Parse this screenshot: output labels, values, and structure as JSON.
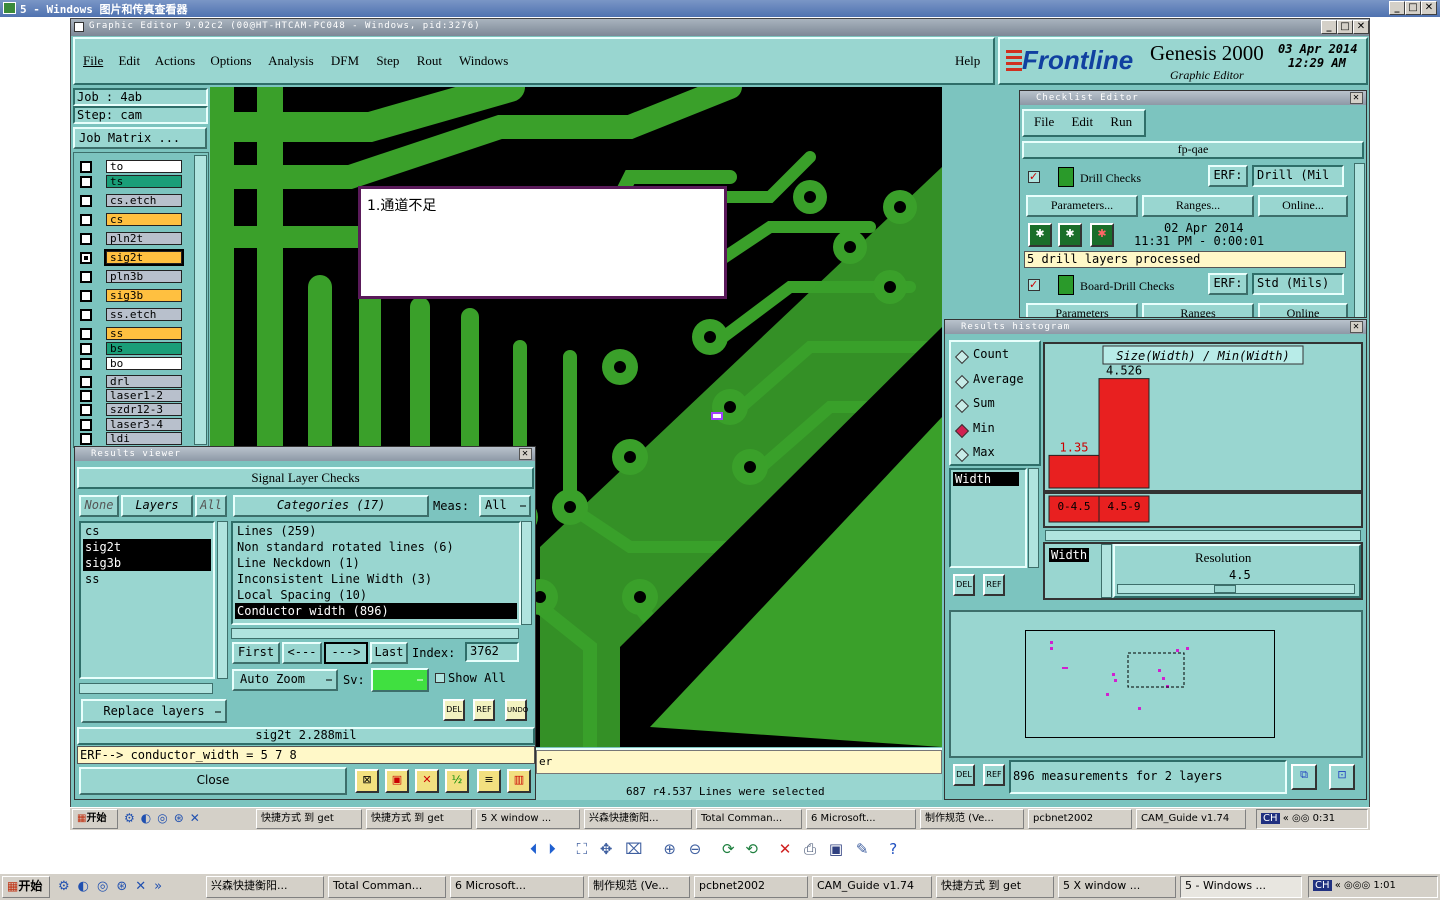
{
  "outer_title": "5 - Windows 图片和传真查看器",
  "editor_title": "Graphic Editor 9.02c2 (00@HT-HTCAM-PC048 - Windows, pid:3276)",
  "menu": [
    "File",
    "Edit",
    "Actions",
    "Options",
    "Analysis",
    "DFM",
    "Step",
    "Rout",
    "Windows"
  ],
  "help": "Help",
  "brand": {
    "logo": "Frontline",
    "product": "Genesis 2000",
    "sub": "Graphic Editor",
    "date": "03 Apr 2014",
    "time": "12:29 AM"
  },
  "job": {
    "job": "Job : 4ab",
    "step": "Step: cam",
    "matrix": "Job Matrix ..."
  },
  "layers": [
    {
      "name": "to",
      "color": "#ffffff"
    },
    {
      "name": "ts",
      "color": "#1a9e78"
    },
    {
      "name": "cs.etch",
      "color": "#b8c0cc"
    },
    {
      "name": "cs",
      "color": "#ffc040"
    },
    {
      "name": "pln2t",
      "color": "#b8c0cc"
    },
    {
      "name": "sig2t",
      "color": "#ffc040"
    },
    {
      "name": "pln3b",
      "color": "#b8c0cc"
    },
    {
      "name": "sig3b",
      "color": "#ffc040"
    },
    {
      "name": "ss.etch",
      "color": "#b8c0cc"
    },
    {
      "name": "ss",
      "color": "#ffc040"
    },
    {
      "name": "bs",
      "color": "#1a9e78"
    },
    {
      "name": "bo",
      "color": "#ffffff"
    },
    {
      "name": "drl",
      "color": "#b8c0cc"
    },
    {
      "name": "laser1-2",
      "color": "#b8c0cc"
    },
    {
      "name": "szdr12-3",
      "color": "#b8c0cc"
    },
    {
      "name": "laser3-4",
      "color": "#b8c0cc"
    },
    {
      "name": "ldi",
      "color": "#b8c0cc"
    }
  ],
  "note": "1.通道不足",
  "results_viewer": {
    "title": "Results viewer",
    "header": "Signal Layer Checks",
    "none": "None",
    "layers_label": "Layers",
    "all": "All",
    "categories_label": "Categories (17)",
    "meas_label": "Meas:",
    "meas_value": "All",
    "layer_list": [
      "cs",
      "sig2t",
      "sig3b",
      "ss"
    ],
    "categories": [
      "Lines (259)",
      "Non standard rotated lines (6)",
      "Line Neckdown (1)",
      "Inconsistent Line Width (3)",
      "Local Spacing (10)",
      "Conductor width (896)"
    ],
    "first": "First",
    "prev": "<---",
    "next": "--->",
    "last": "Last",
    "index_label": "Index:",
    "index_value": "3762",
    "auto_zoom": "Auto Zoom",
    "sv": "Sv:",
    "show_all": "Show All",
    "replace_layers": "Replace layers",
    "del": "DEL",
    "ref": "REF",
    "undo": "UNDO",
    "status": "sig2t 2.288mil",
    "erf": "ERF--> conductor_width = 5 7 8",
    "close": "Close"
  },
  "statusbar": {
    "msg": "687 r4.537 Lines were selected",
    "partial": "er"
  },
  "checklist": {
    "title": "Checklist Editor",
    "menu": [
      "File",
      "Edit",
      "Run"
    ],
    "name": "fp-qae",
    "drill_checks": "Drill Checks",
    "erf": "ERF:",
    "drill_erf": "Drill (Mil",
    "parameters": "Parameters...",
    "ranges": "Ranges...",
    "online": "Online...",
    "run_date": "02 Apr 2014",
    "run_time": "11:31 PM - 0:00:01",
    "drill_msg": "5 drill layers processed",
    "board_drill": "Board-Drill Checks",
    "board_erf": "Std (Mils)",
    "parameters2": "Parameters",
    "ranges2": "Ranges",
    "online2": "Online"
  },
  "histogram": {
    "title": "Results histogram",
    "options": [
      "Count",
      "Average",
      "Sum",
      "Min",
      "Max"
    ],
    "selected": "Min",
    "field": "Width",
    "chart_title": "Size(Width) / Min(Width)",
    "resolution_label": "Resolution",
    "resolution": "4.5",
    "summary": "896 measurements for 2 layers",
    "del": "DEL",
    "ref": "REF"
  },
  "chart_data": {
    "type": "bar",
    "title": "Size(Width) / Min(Width)",
    "categories": [
      "0-4.5",
      "4.5-9"
    ],
    "values": [
      1.35,
      4.526
    ],
    "ylim": [
      0,
      4.8
    ],
    "color": "#e82020"
  },
  "inner_taskbar": {
    "start": "开始",
    "items": [
      "快捷方式 到 get",
      "快捷方式 到 get",
      "5 X window ...",
      "兴森快捷衡阳...",
      "Total Comman...",
      "6 Microsoft...",
      "制作规范 (Ve...",
      "pcbnet2002",
      "CAM_Guide v1.74"
    ],
    "lang": "CH",
    "time": "0:31"
  },
  "outer_taskbar": {
    "start": "开始",
    "items": [
      "兴森快捷衡阳...",
      "Total Comman...",
      "6 Microsoft...",
      "制作规范 (Ve...",
      "pcbnet2002",
      "CAM_Guide v1.74",
      "快捷方式 到 get",
      "5 X window ...",
      "5 - Windows ..."
    ],
    "lang": "CH",
    "time": "1:01"
  }
}
